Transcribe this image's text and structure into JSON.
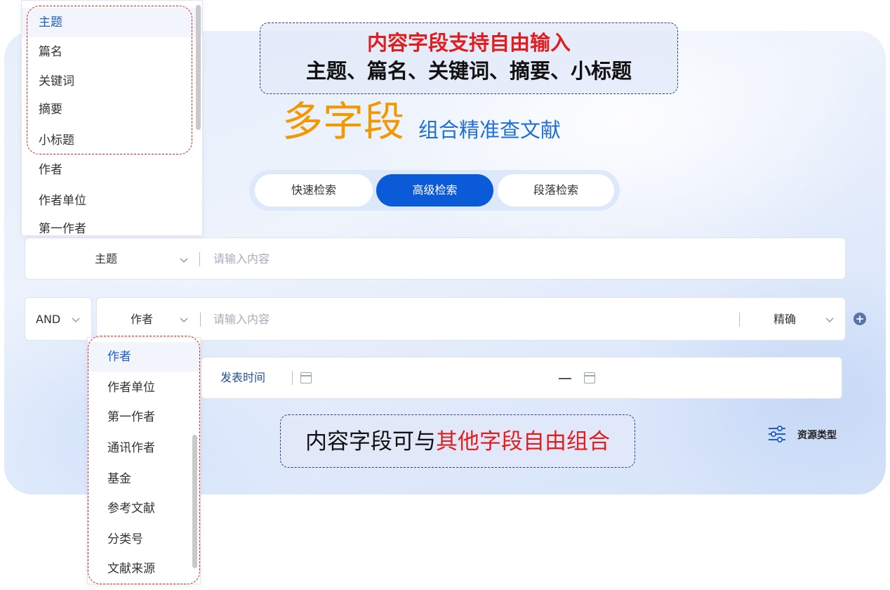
{
  "callout_top": {
    "line1": "内容字段支持自由输入",
    "line2": "主题、篇名、关键词、摘要、小标题"
  },
  "title": {
    "big": "多字段",
    "small": "组合精准查文献"
  },
  "tabs": [
    {
      "label": "快速检索",
      "active": false
    },
    {
      "label": "高级检索",
      "active": true
    },
    {
      "label": "段落检索",
      "active": false
    }
  ],
  "row1": {
    "field": "主题",
    "placeholder": "请输入内容"
  },
  "row2": {
    "logic": "AND",
    "field": "作者",
    "placeholder": "请输入内容",
    "match": "精确"
  },
  "date_row": {
    "label": "发表时间"
  },
  "resource_type": {
    "label": "资源类型",
    "icon": "sliders-icon"
  },
  "callout_bottom": {
    "black": "内容字段可与",
    "red": "其他字段自由组合"
  },
  "dropdown_top": {
    "items": [
      "主题",
      "篇名",
      "关键词",
      "摘要",
      "小标题",
      "作者",
      "作者单位",
      "第一作者"
    ],
    "selected": "主题"
  },
  "dropdown_bottom": {
    "items": [
      "作者",
      "作者单位",
      "第一作者",
      "通讯作者",
      "基金",
      "参考文献",
      "分类号",
      "文献来源"
    ],
    "selected": "作者"
  },
  "colors": {
    "accent": "#0b5ad8",
    "title_orange": "#f39800",
    "title_blue": "#1f6fd6",
    "callout_red": "#e11d1d"
  }
}
